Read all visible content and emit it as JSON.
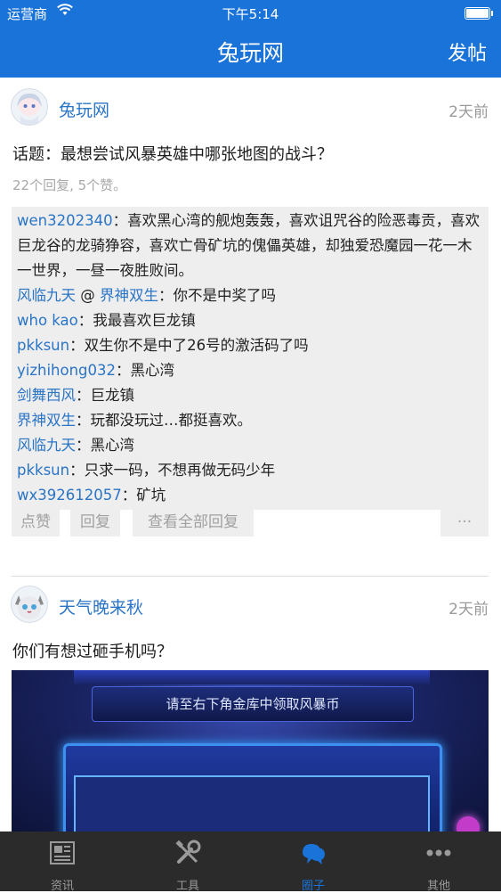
{
  "status_bar": {
    "carrier": "运营商",
    "time": "下午5:14"
  },
  "nav": {
    "title": "兔玩网",
    "post_button": "发帖"
  },
  "posts": [
    {
      "author": "兔玩网",
      "time": "2天前",
      "text": "话题：最想尝试风暴英雄中哪张地图的战斗？",
      "stats": "22个回复, 5个赞。",
      "replies": [
        {
          "user": "wen3202340",
          "text": "：喜欢黑心湾的舰炮轰轰，喜欢诅咒谷的险恶毒贡，喜欢巨龙谷的龙骑狰容，喜欢亡骨矿坑的傀儡英雄，却独爱恐魔园一花一木一世界，一昼一夜胜败间。"
        },
        {
          "user": "风临九天",
          "mid": " @ ",
          "user2": "界神双生",
          "text": "：你不是中奖了吗"
        },
        {
          "user": "who kao",
          "text": "：我最喜欢巨龙镇"
        },
        {
          "user": "pkksun",
          "text": "：双生你不是中了26号的激活码了吗"
        },
        {
          "user": "yizhihong032",
          "text": "：黑心湾"
        },
        {
          "user": "剑舞西风",
          "text": "：巨龙镇"
        },
        {
          "user": "界神双生",
          "text": "：玩都没玩过…都挺喜欢。"
        },
        {
          "user": "风临九天",
          "text": "：黑心湾"
        },
        {
          "user": "pkksun",
          "text": "：只求一码，不想再做无码少年"
        },
        {
          "user": "wx392612057",
          "text": "：矿坑"
        }
      ],
      "actions": {
        "like": "点赞",
        "reply": "回复",
        "view_all": "查看全部回复",
        "more": "···"
      }
    },
    {
      "author": "天气晚来秋",
      "time": "2天前",
      "text": "你们有想过砸手机吗？",
      "image_caption": "请至右下角金库中领取风暴币"
    }
  ],
  "tabs": [
    {
      "label": "资讯",
      "icon": "newspaper-icon"
    },
    {
      "label": "工具",
      "icon": "tools-icon"
    },
    {
      "label": "圈子",
      "icon": "chat-bubbles-icon",
      "active": true
    },
    {
      "label": "其他",
      "icon": "more-dots-icon"
    }
  ],
  "colors": {
    "accent": "#1a73d9",
    "link": "#2a74c6",
    "tabbar": "#2b2b2b"
  }
}
